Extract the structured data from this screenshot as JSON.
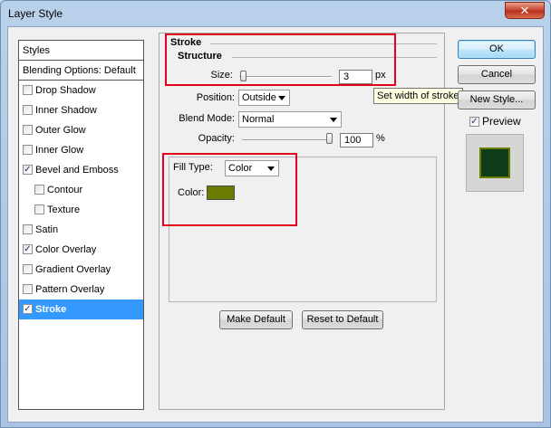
{
  "window": {
    "title": "Layer Style",
    "close_glyph": "✕"
  },
  "styles_list": {
    "header": "Styles",
    "blending_options": "Blending Options: Default",
    "items": [
      {
        "label": "Drop Shadow",
        "checked": false,
        "selected": false,
        "indent": false
      },
      {
        "label": "Inner Shadow",
        "checked": false,
        "selected": false,
        "indent": false
      },
      {
        "label": "Outer Glow",
        "checked": false,
        "selected": false,
        "indent": false
      },
      {
        "label": "Inner Glow",
        "checked": false,
        "selected": false,
        "indent": false
      },
      {
        "label": "Bevel and Emboss",
        "checked": true,
        "selected": false,
        "indent": false
      },
      {
        "label": "Contour",
        "checked": false,
        "selected": false,
        "indent": true
      },
      {
        "label": "Texture",
        "checked": false,
        "selected": false,
        "indent": true
      },
      {
        "label": "Satin",
        "checked": false,
        "selected": false,
        "indent": false
      },
      {
        "label": "Color Overlay",
        "checked": true,
        "selected": false,
        "indent": false
      },
      {
        "label": "Gradient Overlay",
        "checked": false,
        "selected": false,
        "indent": false
      },
      {
        "label": "Pattern Overlay",
        "checked": false,
        "selected": false,
        "indent": false
      },
      {
        "label": "Stroke",
        "checked": true,
        "selected": true,
        "indent": false
      }
    ]
  },
  "stroke": {
    "group_title": "Stroke",
    "structure_title": "Structure",
    "size": {
      "label": "Size:",
      "value": "3",
      "unit": "px",
      "slider_fraction": 0.012
    },
    "position": {
      "label": "Position:",
      "value": "Outside"
    },
    "blend_mode": {
      "label": "Blend Mode:",
      "value": "Normal"
    },
    "opacity": {
      "label": "Opacity:",
      "value": "100",
      "unit": "%",
      "slider_fraction": 1.0
    },
    "fill_type": {
      "label": "Fill Type:",
      "value": "Color"
    },
    "color": {
      "label": "Color:",
      "swatch": "#6b7c00"
    },
    "make_default": "Make Default",
    "reset_to_default": "Reset to Default",
    "tooltip": "Set width of stroke"
  },
  "right_buttons": {
    "ok": "OK",
    "cancel": "Cancel",
    "new_style": "New Style...",
    "preview_label": "Preview",
    "preview_checked": true
  },
  "preview": {
    "fill_color": "#0d3d1a",
    "stroke_color": "#6b7c00"
  },
  "annotation_color": "#e2001a"
}
